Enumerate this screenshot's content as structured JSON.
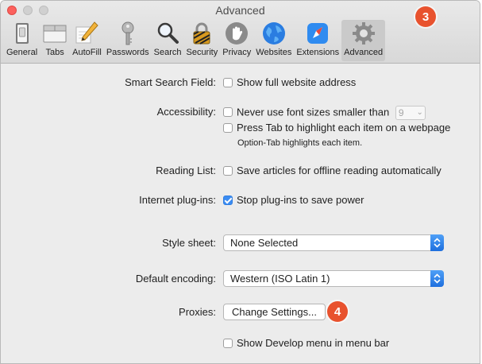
{
  "window": {
    "title": "Advanced"
  },
  "toolbar": {
    "items": [
      {
        "label": "General",
        "icon": "general-switch-icon",
        "active": false
      },
      {
        "label": "Tabs",
        "icon": "tabs-icon",
        "active": false
      },
      {
        "label": "AutoFill",
        "icon": "pencil-icon",
        "active": false
      },
      {
        "label": "Passwords",
        "icon": "key-icon",
        "active": false
      },
      {
        "label": "Search",
        "icon": "magnifier-icon",
        "active": false
      },
      {
        "label": "Security",
        "icon": "padlock-icon",
        "active": false
      },
      {
        "label": "Privacy",
        "icon": "hand-icon",
        "active": false
      },
      {
        "label": "Websites",
        "icon": "globe-icon",
        "active": false
      },
      {
        "label": "Extensions",
        "icon": "puzzle-compass-icon",
        "active": false
      },
      {
        "label": "Advanced",
        "icon": "gear-icon",
        "active": true
      }
    ]
  },
  "badges": {
    "step3": "3",
    "step4": "4"
  },
  "settings": {
    "smart_search": {
      "label": "Smart Search Field:",
      "option": "Show full website address",
      "checked": false
    },
    "accessibility": {
      "label": "Accessibility:",
      "font_option": "Never use font sizes smaller than",
      "font_value": "9",
      "font_checked": false,
      "tab_option": "Press Tab to highlight each item on a webpage",
      "tab_checked": false,
      "tab_note": "Option-Tab highlights each item."
    },
    "reading_list": {
      "label": "Reading List:",
      "option": "Save articles for offline reading automatically",
      "checked": false
    },
    "plugins": {
      "label": "Internet plug-ins:",
      "option": "Stop plug-ins to save power",
      "checked": true
    },
    "style_sheet": {
      "label": "Style sheet:",
      "value": "None Selected"
    },
    "encoding": {
      "label": "Default encoding:",
      "value": "Western (ISO Latin 1)"
    },
    "proxies": {
      "label": "Proxies:",
      "button": "Change Settings..."
    },
    "develop": {
      "option": "Show Develop menu in menu bar",
      "checked": false
    }
  },
  "colors": {
    "badge": "#e8522e",
    "checkbox_checked": "#3b8cf2",
    "close_light": "#fc615d"
  }
}
